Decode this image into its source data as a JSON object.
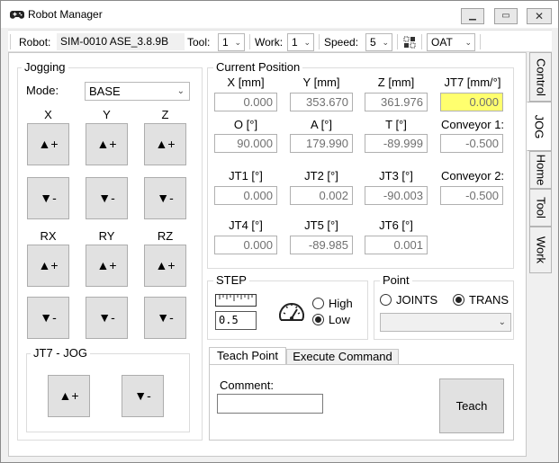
{
  "window": {
    "title": "Robot Manager"
  },
  "toolbar": {
    "robot_label": "Robot:",
    "robot_value": "SIM-0010 ASE_3.8.9B",
    "tool_label": "Tool:",
    "tool_value": "1",
    "work_label": "Work:",
    "work_value": "1",
    "speed_label": "Speed:",
    "speed_value": "5",
    "coord_value": "OAT"
  },
  "side_tabs": [
    "Control",
    "JOG",
    "Home",
    "Tool",
    "Work"
  ],
  "jogging": {
    "title": "Jogging",
    "mode_label": "Mode:",
    "mode_value": "BASE",
    "axes_row1": [
      "X",
      "Y",
      "Z"
    ],
    "axes_row2": [
      "RX",
      "RY",
      "RZ"
    ],
    "plus_label": "▲+",
    "minus_label": "▼-"
  },
  "jt7": {
    "title": "JT7 - JOG",
    "plus_label": "▲+",
    "minus_label": "▼-"
  },
  "position": {
    "title": "Current Position",
    "rows": [
      [
        {
          "label": "X [mm]",
          "value": "0.000"
        },
        {
          "label": "Y [mm]",
          "value": "353.670"
        },
        {
          "label": "Z  [mm]",
          "value": "361.976"
        },
        {
          "label": "JT7 [mm/°]",
          "value": "0.000",
          "highlight": true
        }
      ],
      [
        {
          "label": "O [°]",
          "value": "90.000"
        },
        {
          "label": "A [°]",
          "value": "179.990"
        },
        {
          "label": "T [°]",
          "value": "-89.999"
        },
        {
          "label": "Conveyor 1:",
          "value": "-0.500"
        }
      ],
      [
        {
          "label": "JT1 [°]",
          "value": "0.000"
        },
        {
          "label": "JT2 [°]",
          "value": "0.002"
        },
        {
          "label": "JT3 [°]",
          "value": "-90.003"
        },
        {
          "label": "Conveyor 2:",
          "value": "-0.500"
        }
      ],
      [
        {
          "label": "JT4 [°]",
          "value": "0.000"
        },
        {
          "label": "JT5 [°]",
          "value": "-89.985"
        },
        {
          "label": "JT6 [°]",
          "value": "0.001"
        }
      ]
    ]
  },
  "step": {
    "title": "STEP",
    "value": "0.5",
    "high_label": "High",
    "low_label": "Low",
    "selected": "Low"
  },
  "point": {
    "title": "Point",
    "joints_label": "JOINTS",
    "trans_label": "TRANS",
    "selected": "TRANS",
    "dropdown_value": ""
  },
  "teach": {
    "tabs": [
      "Teach Point",
      "Execute Command"
    ],
    "active_tab": "Teach Point",
    "comment_label": "Comment:",
    "comment_value": "",
    "teach_button": "Teach"
  },
  "colors": {
    "highlight": "#ffff6e",
    "button_bg": "#e1e1e1"
  },
  "icons": [
    "gamepad-icon",
    "minimize-icon",
    "maximize-icon",
    "close-icon",
    "ruler-icon",
    "speedometer-icon",
    "grid-icon"
  ]
}
